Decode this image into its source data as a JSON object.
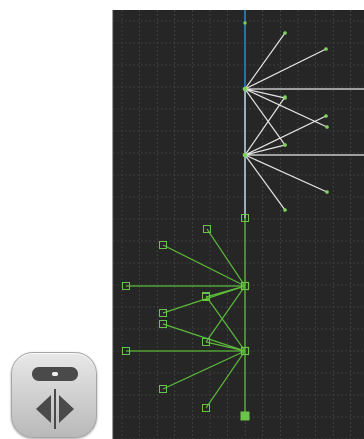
{
  "canvas": {
    "background": "#262626",
    "grid_color": "#4f4f4f",
    "axis_color": "#1e90d8",
    "upper_tree_color": "#e6e6e6",
    "upper_node_color": "#7fd35a",
    "lower_tree_color": "#5bb83a",
    "lower_handle_color": "#6ac449"
  },
  "toolbar": {
    "mirror_button_icon": "mirror-flip-icon"
  }
}
